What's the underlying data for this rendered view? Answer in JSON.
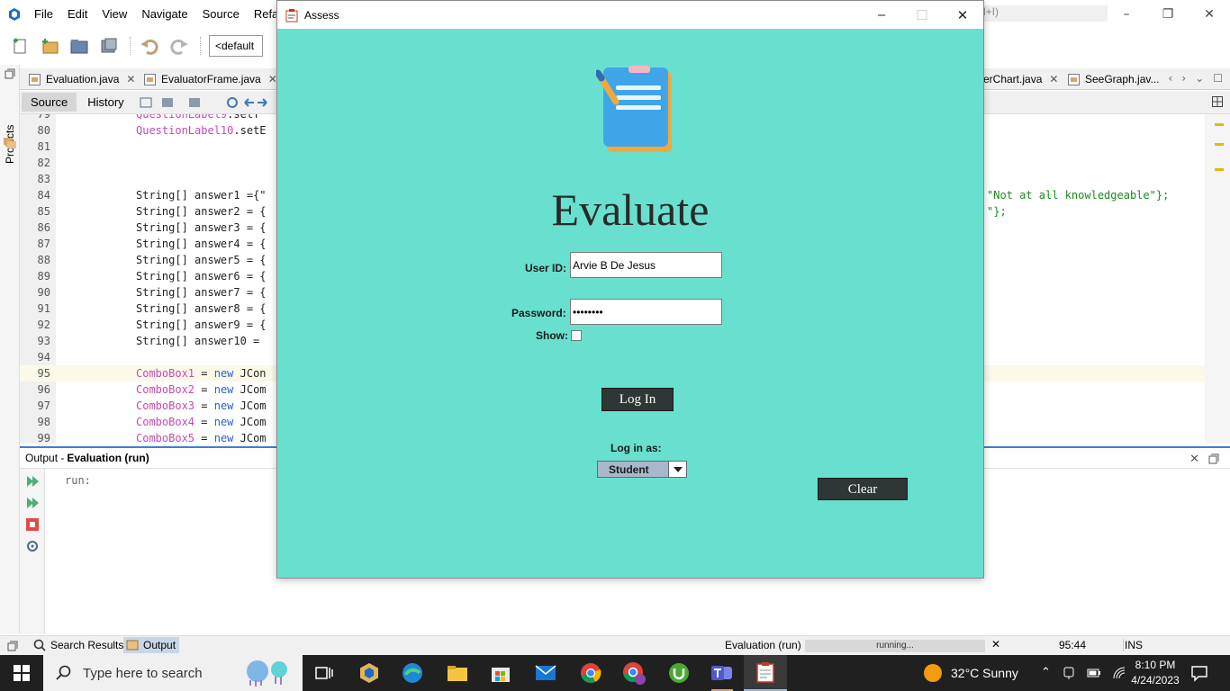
{
  "ide": {
    "menus": [
      "File",
      "Edit",
      "View",
      "Navigate",
      "Source",
      "Refacto"
    ],
    "search_hint": "rl+I)",
    "config_combo": "<default",
    "projects_label": "Projects",
    "tabs": [
      "Evaluation.java",
      "EvaluatorFrame.java",
      "erChart.java",
      "SeeGraph.jav..."
    ],
    "source_tab": "Source",
    "history_tab": "History"
  },
  "code": {
    "lines": [
      {
        "n": "79",
        "a": "QuestionLabel9",
        "b": ".setT"
      },
      {
        "n": "80",
        "a": "QuestionLabel10",
        "b": ".setE"
      },
      {
        "n": "81",
        "a": "",
        "b": ""
      },
      {
        "n": "82",
        "a": "",
        "b": ""
      },
      {
        "n": "83",
        "a": "",
        "b": ""
      },
      {
        "n": "84",
        "a": "",
        "b": "String[] answer1 ={\""
      },
      {
        "n": "85",
        "a": "",
        "b": "String[] answer2 = {"
      },
      {
        "n": "86",
        "a": "",
        "b": "String[] answer3 = {"
      },
      {
        "n": "87",
        "a": "",
        "b": "String[] answer4 = {"
      },
      {
        "n": "88",
        "a": "",
        "b": "String[] answer5 = {"
      },
      {
        "n": "89",
        "a": "",
        "b": "String[] answer6 = {"
      },
      {
        "n": "90",
        "a": "",
        "b": "String[] answer7 = {"
      },
      {
        "n": "91",
        "a": "",
        "b": "String[] answer8 = {"
      },
      {
        "n": "92",
        "a": "",
        "b": "String[] answer9 = {"
      },
      {
        "n": "93",
        "a": "",
        "b": "String[] answer10 = "
      },
      {
        "n": "94",
        "a": "",
        "b": ""
      },
      {
        "n": "95",
        "a": "ComboBox1",
        "b": " = ",
        "k": "new",
        "c": " JCon"
      },
      {
        "n": "96",
        "a": "ComboBox2",
        "b": " = ",
        "k": "new",
        "c": " JCom"
      },
      {
        "n": "97",
        "a": "ComboBox3",
        "b": " = ",
        "k": "new",
        "c": " JCom"
      },
      {
        "n": "98",
        "a": "ComboBox4",
        "b": " = ",
        "k": "new",
        "c": " JCom"
      },
      {
        "n": "99",
        "a": "ComboBox5",
        "b": " = ",
        "k": "new",
        "c": " JCom"
      }
    ],
    "right_84": "\"Not at all knowledgeable\"};",
    "right_85": "\"};"
  },
  "output": {
    "title_prefix": "Output - ",
    "title_bold": "Evaluation (run)",
    "text": "run:"
  },
  "status": {
    "search_results": "Search Results",
    "output_tab": "Output",
    "run_name": "Evaluation (run)",
    "progress_text": "running...",
    "progress_level": "indeterminate",
    "position": "95:44",
    "mode": "INS"
  },
  "dialog": {
    "title": "Assess",
    "heading": "Evaluate",
    "user_id_label": "User ID:",
    "user_id_value": "Arvie B De Jesus",
    "password_label": "Password:",
    "password_value": "••••••••",
    "show_label": "Show:",
    "show_checked": false,
    "login_button": "Log In",
    "login_as_label": "Log in as:",
    "role_selected": "Student",
    "clear_button": "Clear",
    "colors": {
      "background": "#69e0cf",
      "button": "#2e3736",
      "combo": "#a9b7cc"
    }
  },
  "taskbar": {
    "search_placeholder": "Type here to search",
    "weather": "32°C  Sunny",
    "time": "8:10 PM",
    "date": "4/24/2023"
  }
}
